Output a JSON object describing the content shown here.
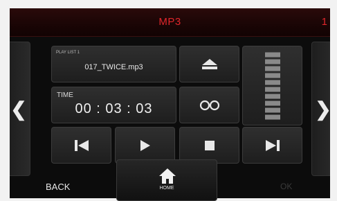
{
  "header": {
    "title": "MP3",
    "right_fragment": "1"
  },
  "navigation": {
    "prev_glyph": "❮",
    "next_glyph": "❯"
  },
  "playlist": {
    "label": "PLAY LIST 1",
    "filename": "017_TWICE.mp3"
  },
  "time": {
    "label": "TIME",
    "value": "00 : 03 : 03"
  },
  "volume": {
    "segments": 10
  },
  "controls": {
    "eject": "eject-icon",
    "repeat": "repeat-icon",
    "previous": "skip-previous-icon",
    "play": "play-icon",
    "stop": "stop-icon",
    "next": "skip-next-icon"
  },
  "footer": {
    "back_label": "BACK",
    "home_label": "HOME",
    "ok_label": "OK"
  },
  "colors": {
    "accent": "#e0262b",
    "background": "#0c0c0c",
    "tile": "#2a2a2a",
    "text": "#e8e8e8",
    "disabled": "#3a3a3a"
  }
}
